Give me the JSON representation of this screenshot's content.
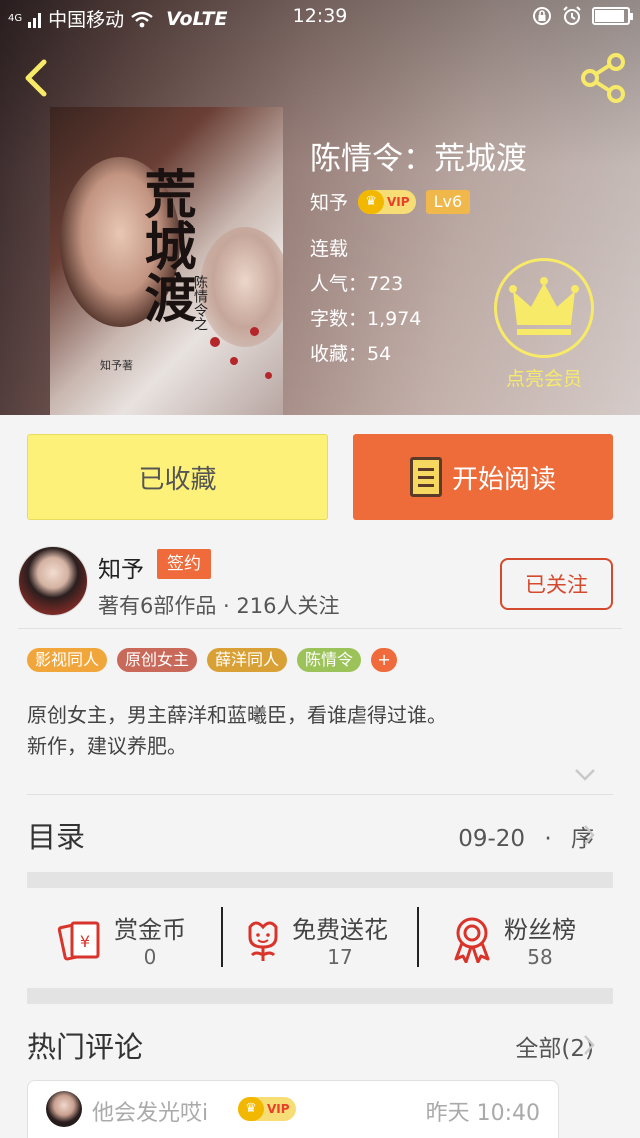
{
  "status_bar": {
    "carrier": "中国移动",
    "network": "VoLTE",
    "signal_tag": "4G",
    "time": "12:39",
    "battery_level": 0.9
  },
  "book": {
    "title": "陈情令：荒城渡",
    "author": "知予",
    "vip_label": "VIP",
    "level": "Lv6",
    "status": "连载",
    "popularity": "人气：723",
    "word_count": "字数：1,974",
    "collections": "收藏：54",
    "member_label": "点亮会员",
    "cover": {
      "title": "荒城渡",
      "subtitle": "陈情令之",
      "author_mark": "知予著"
    }
  },
  "actions": {
    "collect_label": "已收藏",
    "read_label": "开始阅读"
  },
  "author_info": {
    "name": "知予",
    "badge": "签约",
    "stats": "著有6部作品 · 216人关注",
    "follow_label": "已关注"
  },
  "tags": [
    {
      "label": "影视同人",
      "color": "#f0a63a"
    },
    {
      "label": "原创女主",
      "color": "#c9695a"
    },
    {
      "label": "薛洋同人",
      "color": "#d9a035"
    },
    {
      "label": "陈情令",
      "color": "#9cc25a"
    }
  ],
  "tag_add": "+",
  "description": [
    "原创女主，男主薛洋和蓝曦臣，看谁虐得过谁。",
    "新作，建议养肥。"
  ],
  "catalog": {
    "label": "目录",
    "date": "09-20",
    "separator": "·",
    "latest": "序"
  },
  "stats": [
    {
      "label": "赏金币",
      "value": "0",
      "icon": "red-envelope-icon"
    },
    {
      "label": "免费送花",
      "value": "17",
      "icon": "flower-icon"
    },
    {
      "label": "粉丝榜",
      "value": "58",
      "icon": "ribbon-medal-icon"
    }
  ],
  "comments": {
    "title": "热门评论",
    "all_label": "全部(2)",
    "first": {
      "user": "他会发光哎i",
      "vip": "VIP",
      "time": "昨天 10:40"
    }
  },
  "colors": {
    "accent": "#ee6b3a",
    "collect": "#fdf17a",
    "member": "#f7ea68",
    "follow": "#d44a2e"
  }
}
